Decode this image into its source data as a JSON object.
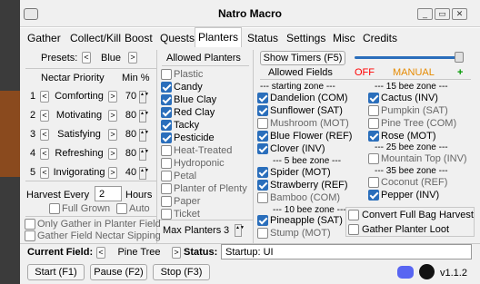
{
  "window": {
    "title": "Natro Macro"
  },
  "tabs": [
    "Gather",
    "Collect/Kill",
    "Boost",
    "Quests",
    "Planters",
    "Status",
    "Settings",
    "Misc",
    "Credits"
  ],
  "left": {
    "presets_label": "Presets:",
    "preset_value": "Blue",
    "priority_header": "Nectar Priority",
    "min_header": "Min %",
    "rows": [
      {
        "num": "1",
        "name": "Comforting",
        "min": "70"
      },
      {
        "num": "2",
        "name": "Motivating",
        "min": "80"
      },
      {
        "num": "3",
        "name": "Satisfying",
        "min": "80"
      },
      {
        "num": "4",
        "name": "Refreshing",
        "min": "80"
      },
      {
        "num": "5",
        "name": "Invigorating",
        "min": "40"
      }
    ],
    "harvest_label": "Harvest Every",
    "harvest_value": "2",
    "hours_label": "Hours",
    "full_grown": "Full Grown",
    "auto": "Auto",
    "only_gather": "Only Gather in Planter Field",
    "gather_nectar": "Gather Field Nectar Sipping"
  },
  "planters": {
    "header": "Allowed Planters",
    "items": [
      {
        "label": "Plastic",
        "checked": false
      },
      {
        "label": "Candy",
        "checked": true
      },
      {
        "label": "Blue Clay",
        "checked": true
      },
      {
        "label": "Red Clay",
        "checked": true
      },
      {
        "label": "Tacky",
        "checked": true
      },
      {
        "label": "Pesticide",
        "checked": true
      },
      {
        "label": "Heat-Treated",
        "checked": false
      },
      {
        "label": "Hydroponic",
        "checked": false
      },
      {
        "label": "Petal",
        "checked": false
      },
      {
        "label": "Planter of Plenty",
        "checked": false
      },
      {
        "label": "Paper",
        "checked": false
      },
      {
        "label": "Ticket",
        "checked": false
      }
    ],
    "max_label": "Max Planters",
    "max_value": "3"
  },
  "top": {
    "show_timers": "Show Timers (F5)"
  },
  "fields": {
    "header": "Allowed Fields",
    "off": "OFF",
    "manual": "MANUAL",
    "plus": "+",
    "starting_zone": "starting zone",
    "five_zone": "5 bee zone",
    "ten_zone": "10 bee zone",
    "fifteen_zone": "15 bee zone",
    "twentyfive_zone": "25 bee zone",
    "thirtyfive_zone": "35 bee zone",
    "col1_a": [
      {
        "label": "Dandelion (COM)",
        "checked": true
      },
      {
        "label": "Sunflower (SAT)",
        "checked": true
      },
      {
        "label": "Mushroom (MOT)",
        "checked": false
      },
      {
        "label": "Blue Flower (REF)",
        "checked": true
      },
      {
        "label": "Clover (INV)",
        "checked": true
      }
    ],
    "col1_b": [
      {
        "label": "Spider (MOT)",
        "checked": true
      },
      {
        "label": "Strawberry (REF)",
        "checked": true
      },
      {
        "label": "Bamboo (COM)",
        "checked": false
      }
    ],
    "col1_c": [
      {
        "label": "Pineapple (SAT)",
        "checked": true
      },
      {
        "label": "Stump (MOT)",
        "checked": false
      }
    ],
    "col2_a": [
      {
        "label": "Cactus (INV)",
        "checked": true
      },
      {
        "label": "Pumpkin (SAT)",
        "checked": false
      },
      {
        "label": "Pine Tree (COM)",
        "checked": false
      },
      {
        "label": "Rose (MOT)",
        "checked": true
      }
    ],
    "col2_b": [
      {
        "label": "Mountain Top (INV)",
        "checked": false
      }
    ],
    "col2_c": [
      {
        "label": "Coconut (REF)",
        "checked": false
      },
      {
        "label": "Pepper (INV)",
        "checked": true
      }
    ],
    "convert": "Convert Full Bag Harvest",
    "gather_loot": "Gather Planter Loot"
  },
  "bottom": {
    "current_label": "Current Field:",
    "current_value": "Pine Tree",
    "status_label": "Status:",
    "status_value": "Startup: UI",
    "start": "Start (F1)",
    "pause": "Pause (F2)",
    "stop": "Stop (F3)",
    "version": "v1.1.2"
  },
  "colors": {
    "off": "#ff0000",
    "manual": "#e68a00",
    "plus": "#009900",
    "check": "#2a6ebb"
  }
}
